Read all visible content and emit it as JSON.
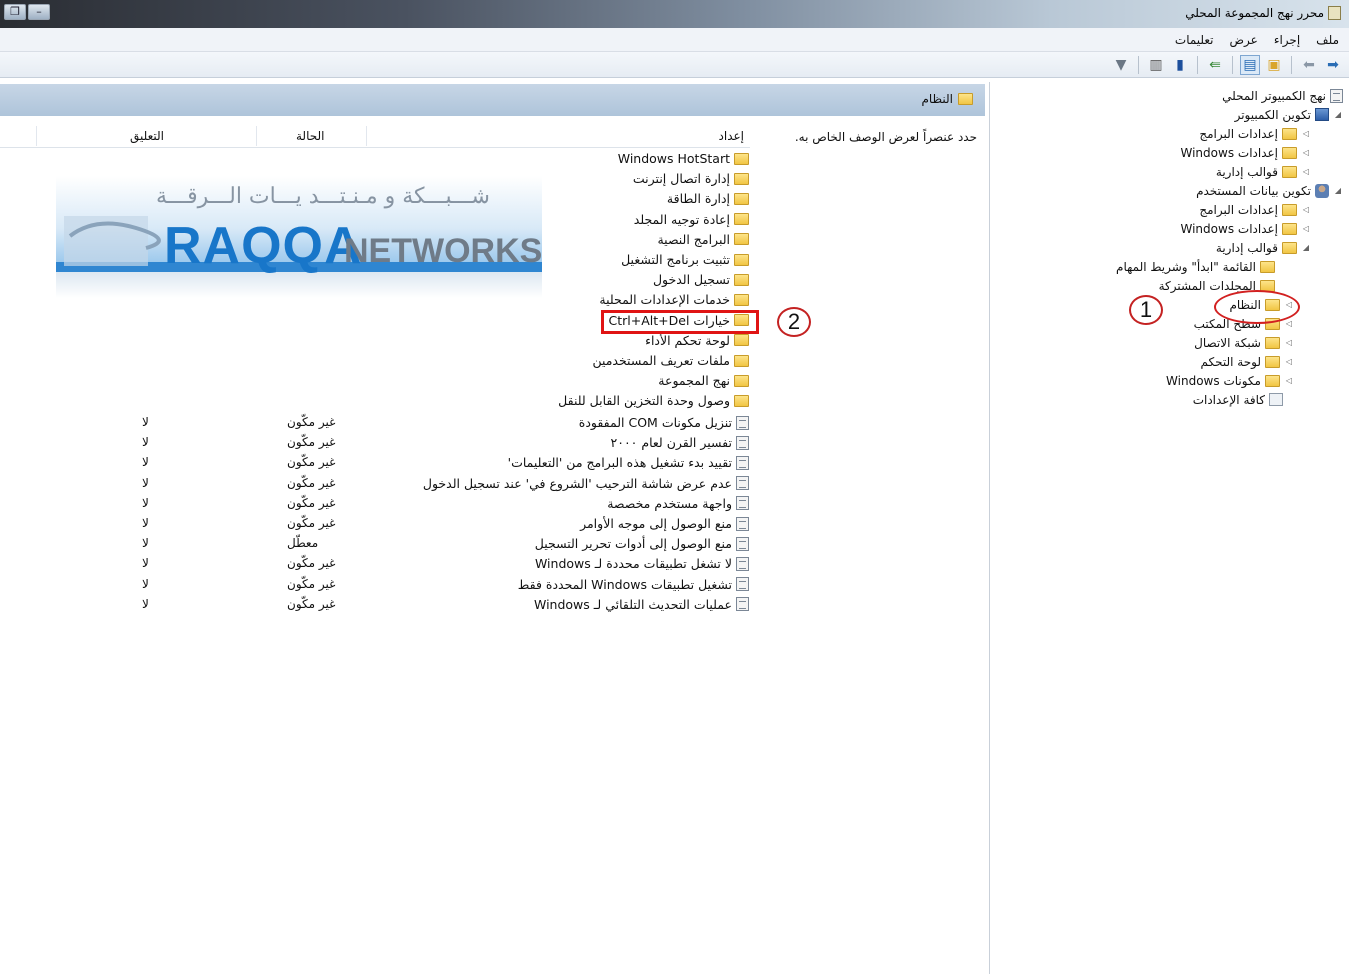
{
  "window": {
    "title": "محرر نهج المجموعة المحلي",
    "min_glyph": "–",
    "restore_glyph": "❐"
  },
  "menu": {
    "items": [
      "ملف",
      "إجراء",
      "عرض",
      "تعليمات"
    ]
  },
  "toolbar": {
    "icons": [
      "forward-arrow-icon",
      "back-arrow-icon",
      "up-folder-icon",
      "show-hide-tree-icon",
      "export-list-icon",
      "help-icon",
      "extended-view-icon",
      "filter-icon"
    ]
  },
  "tree": {
    "root": "نهج الكمبيوتر المحلي",
    "computer_config": "تكوين الكمبيوتر",
    "cc_software": "إعدادات البرامج",
    "cc_windows": "إعدادات Windows",
    "cc_admin": "قوالب إدارية",
    "user_config": "تكوين بيانات المستخدم",
    "uc_software": "إعدادات البرامج",
    "uc_windows": "إعدادات Windows",
    "uc_admin": "قوالب إدارية",
    "start_menu": "القائمة \"ابدأ\" وشريط المهام",
    "shared_folders": "المجلدات المشتركة",
    "system": "النظام",
    "desktop": "سطح المكتب",
    "network": "شبكة الاتصال",
    "control_panel": "لوحة التحكم",
    "windows_components": "مكونات Windows",
    "all_settings": "كافة الإعدادات"
  },
  "callouts": {
    "one": "1",
    "two": "2"
  },
  "header": {
    "title": "النظام"
  },
  "description": {
    "text": "حدد عنصراً لعرض الوصف الخاص به."
  },
  "columns": {
    "setting": "إعداد",
    "state": "الحالة",
    "comment": "التعليق"
  },
  "logo": {
    "arabic": "شـــبـــكة و مـنـتـــد يـــات الـــرقـــة",
    "en_part1": "RAQQA",
    "en_part2": "NETWORKS"
  },
  "folders": [
    "Windows HotStart",
    "إدارة اتصال إنترنت",
    "إدارة الطاقة",
    "إعادة توجيه المجلد",
    "البرامج النصية",
    "تثبيت برنامج التشغيل",
    "تسجيل الدخول",
    "خدمات الإعدادات المحلية",
    "خيارات Ctrl+Alt+Del",
    "لوحة تحكم الأداء",
    "ملفات تعريف المستخدمين",
    "نهج المجموعة",
    "وصول وحدة التخزين القابل للنقل"
  ],
  "settings": [
    {
      "name": "تنزيل مكونات COM المفقودة",
      "state": "غير مكّون",
      "comment": "لا"
    },
    {
      "name": "تفسير القرن لعام ٢٠٠٠",
      "state": "غير مكّون",
      "comment": "لا"
    },
    {
      "name": "تقييد بدء تشغيل هذه البرامج من 'التعليمات'",
      "state": "غير مكّون",
      "comment": "لا"
    },
    {
      "name": "عدم عرض شاشة الترحيب 'الشروع في' عند تسجيل الدخول",
      "state": "غير مكّون",
      "comment": "لا"
    },
    {
      "name": "واجهة مستخدم مخصصة",
      "state": "غير مكّون",
      "comment": "لا"
    },
    {
      "name": "منع الوصول إلى موجه الأوامر",
      "state": "غير مكّون",
      "comment": "لا"
    },
    {
      "name": "منع الوصول إلى أدوات تحرير التسجيل",
      "state": "معطّل",
      "comment": "لا"
    },
    {
      "name": "لا تشغل تطبيقات محددة لـ Windows",
      "state": "غير مكّون",
      "comment": "لا"
    },
    {
      "name": "تشغيل تطبيقات Windows المحددة فقط",
      "state": "غير مكّون",
      "comment": "لا"
    },
    {
      "name": "عمليات التحديث التلقائي لـ Windows",
      "state": "غير مكّون",
      "comment": "لا"
    }
  ]
}
